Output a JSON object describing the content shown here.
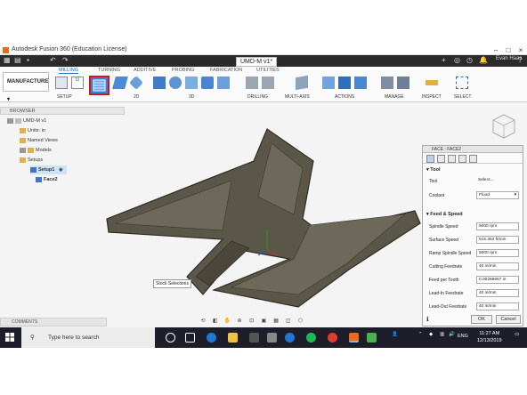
{
  "window": {
    "title": "Autodesk Fusion 360 (Education License)",
    "document_tab": "UMD-M v1*",
    "user": "Evan Haas"
  },
  "ribbon": {
    "workspace": "MANUFACTURE",
    "tabs": [
      "MILLING",
      "TURNING",
      "ADDITIVE",
      "PROBING",
      "FABRICATION",
      "UTILITIES"
    ],
    "active_tab": "MILLING",
    "groups": [
      "SETUP",
      "2D",
      "3D",
      "DRILLING",
      "MULTI-AXIS",
      "ACTIONS",
      "MANAGE",
      "INSPECT",
      "SELECT"
    ],
    "highlight_color": "#cc1a1a"
  },
  "browser": {
    "header": "BROWSER",
    "items": [
      {
        "label": "UMD-M v1"
      },
      {
        "label": "Units: in"
      },
      {
        "label": "Named Views"
      },
      {
        "label": "Models"
      },
      {
        "label": "Setups"
      },
      {
        "label": "Setup1"
      },
      {
        "label": "Face2"
      }
    ]
  },
  "viewport": {
    "tooltip": "Stock Selections",
    "model_color": "#5a5648"
  },
  "dialog": {
    "title": "FACE : FACE2",
    "sections": {
      "tool": "Tool",
      "feed": "Feed & Speed"
    },
    "fields": [
      {
        "label": "Tool",
        "value": "Select..."
      },
      {
        "label": "Coolant",
        "value": "Flood"
      },
      {
        "label": "Spindle Speed",
        "value": "5000 rpm"
      },
      {
        "label": "Surface Speed",
        "value": "515.353 ft/min"
      },
      {
        "label": "Ramp Spindle Speed",
        "value": "5000 rpm"
      },
      {
        "label": "Cutting Feedrate",
        "value": "40 in/min"
      },
      {
        "label": "Feed per Tooth",
        "value": "0.00266667 in"
      },
      {
        "label": "Lead-In Feedrate",
        "value": "40 in/min"
      },
      {
        "label": "Lead-Out Feedrate",
        "value": "40 in/min"
      }
    ],
    "ok": "OK",
    "cancel": "Cancel"
  },
  "comments": "COMMENTS",
  "taskbar": {
    "search_placeholder": "Type here to search",
    "language": "ENG",
    "time": "11:27 AM",
    "date": "12/13/2019"
  }
}
